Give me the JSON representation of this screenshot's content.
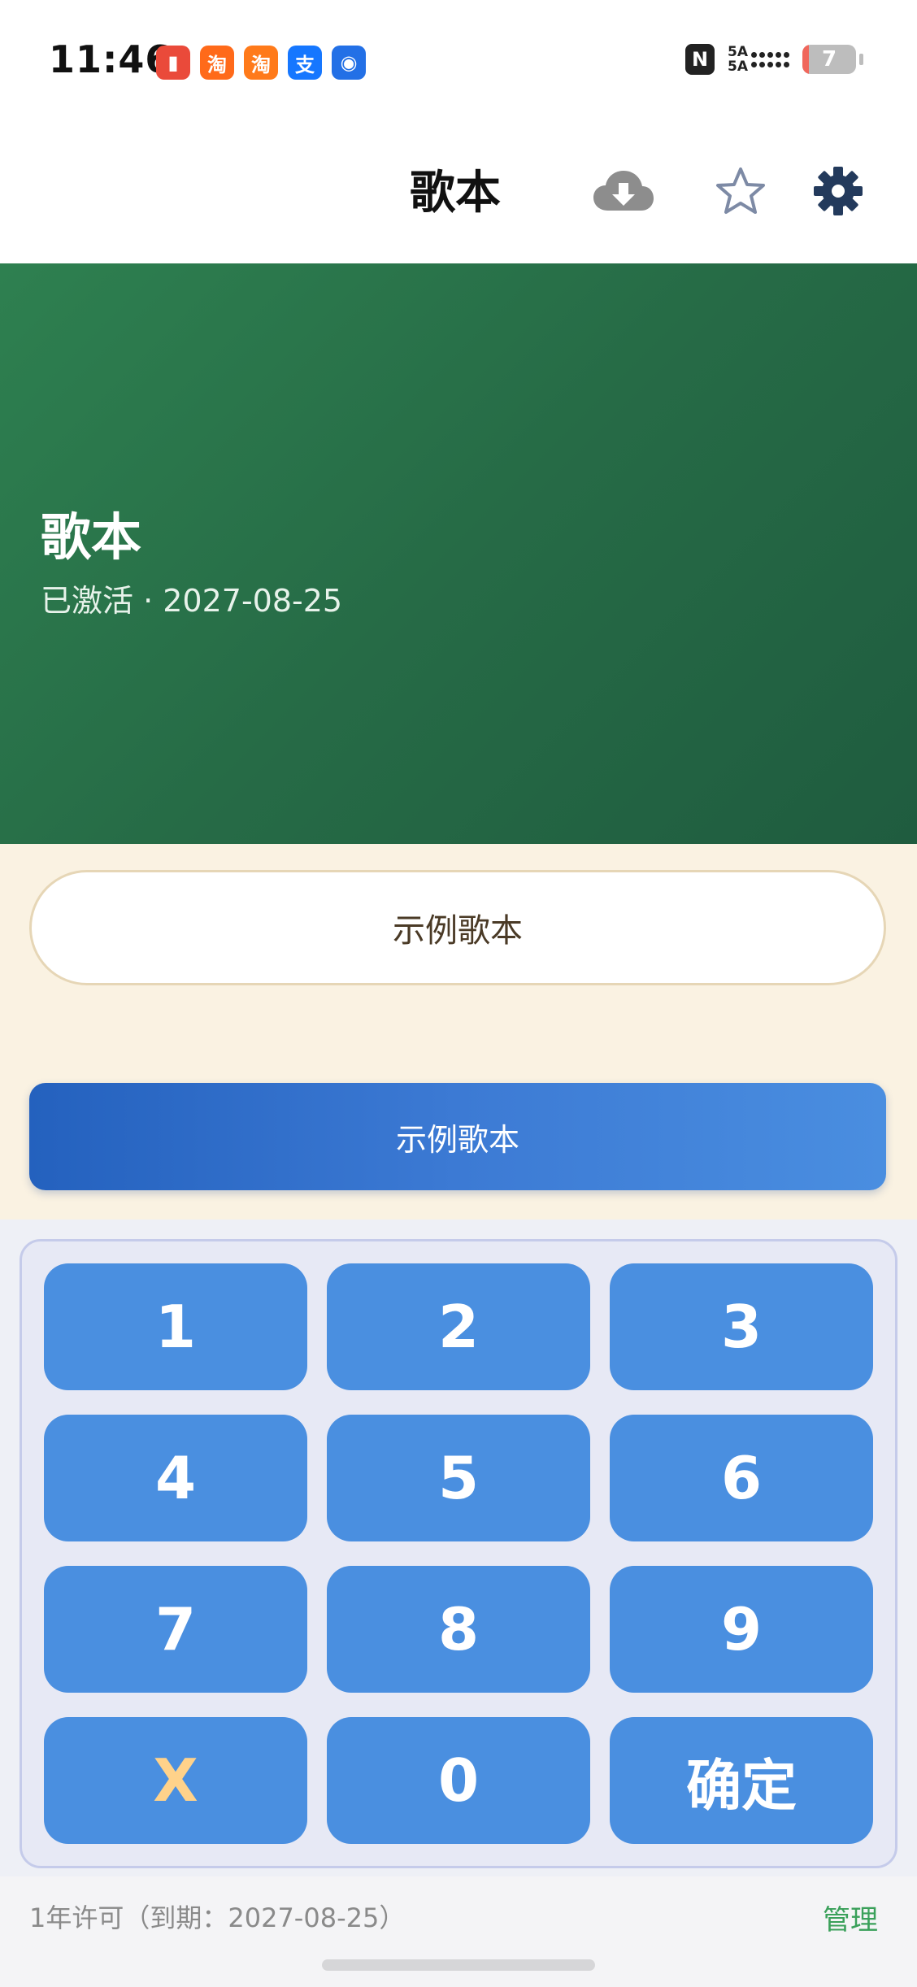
{
  "status_bar": {
    "time": "11:46",
    "apps": [
      {
        "name": "record-app-icon",
        "glyph": "▮",
        "color": "#ea4a3a"
      },
      {
        "name": "taobao-icon",
        "glyph": "淘",
        "color": "#ff6a1a"
      },
      {
        "name": "taobao-deals-icon",
        "glyph": "淘",
        "color": "#ff7a1a"
      },
      {
        "name": "alipay-icon",
        "glyph": "支",
        "color": "#1677ff"
      },
      {
        "name": "bulb-app-icon",
        "glyph": "◉",
        "color": "#2370e6"
      }
    ],
    "nfc": "N",
    "signal_label_1": "5A",
    "signal_label_2": "5A",
    "battery": "7",
    "battery_level": 0.07
  },
  "app_bar": {
    "title": "歌本",
    "icons": [
      "cloud-download-icon",
      "star-icon",
      "gear-icon"
    ]
  },
  "hero": {
    "title": "歌本",
    "subtitle": "已激活 · 2027-08-25",
    "colors": {
      "start": "#2e8050",
      "end": "#1f5c3f"
    }
  },
  "selector": {
    "pill_label": "示例歌本",
    "button_label": "示例歌本"
  },
  "keypad": {
    "keys": [
      "1",
      "2",
      "3",
      "4",
      "5",
      "6",
      "7",
      "8",
      "9",
      "X",
      "0",
      "确定"
    ],
    "key_color": "#4a8fe0",
    "x_color": "#ffd28a"
  },
  "footer": {
    "license": "1年许可（到期：2027-08-25）",
    "manage": "管理"
  }
}
